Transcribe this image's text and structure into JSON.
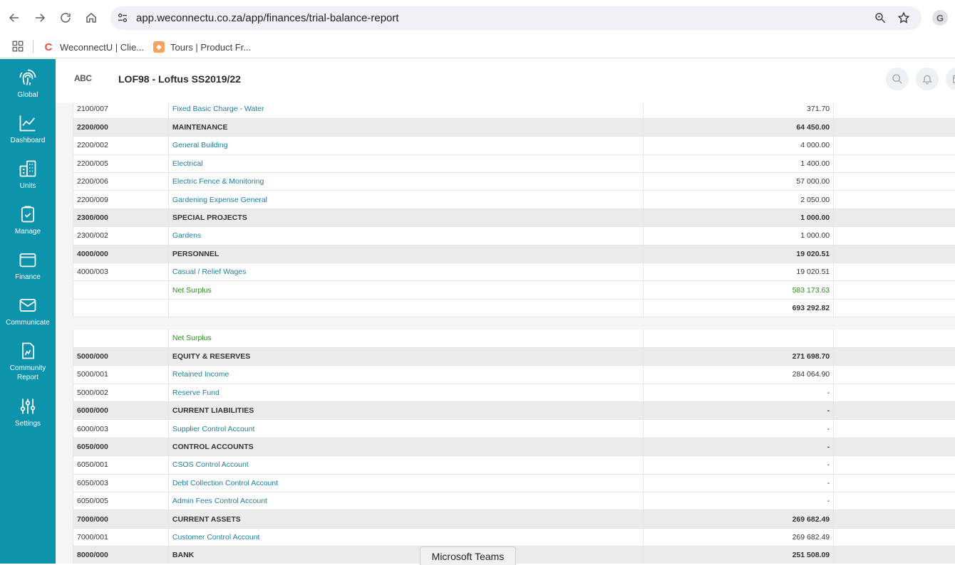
{
  "browser": {
    "url": "app.weconnectu.co.za/app/finances/trial-balance-report",
    "bookmarks": [
      {
        "label": "WeconnectU | Clie..."
      },
      {
        "label": "Tours | Product Fr..."
      }
    ],
    "profile_letter": "G"
  },
  "sidebar": {
    "items": [
      {
        "label": "Global",
        "icon": "fingerprint-icon"
      },
      {
        "label": "Dashboard",
        "icon": "line-chart-icon"
      },
      {
        "label": "Units",
        "icon": "building-icon"
      },
      {
        "label": "Manage",
        "icon": "clipboard-check-icon"
      },
      {
        "label": "Finance",
        "icon": "wallet-icon"
      },
      {
        "label": "Communicate",
        "icon": "envelope-icon"
      },
      {
        "label": "Community",
        "label2": "Report",
        "icon": "report-icon"
      },
      {
        "label": "Settings",
        "icon": "sliders-icon"
      }
    ]
  },
  "header": {
    "logo": "ABC",
    "title": "LOF98 - Loftus SS2019/22"
  },
  "table1": [
    {
      "code": "2100/007",
      "name": "Fixed Basic Charge - Water",
      "amount": "371.70",
      "type": "item"
    },
    {
      "code": "2200/000",
      "name": "MAINTENANCE",
      "amount": "64 450.00",
      "type": "head"
    },
    {
      "code": "2200/002",
      "name": "General Building",
      "amount": "4 000.00",
      "type": "item"
    },
    {
      "code": "2200/005",
      "name": "Electrical",
      "amount": "1 400.00",
      "type": "item"
    },
    {
      "code": "2200/006",
      "name": "Electric Fence & Monitoring",
      "amount": "57 000.00",
      "type": "item"
    },
    {
      "code": "2200/009",
      "name": "Gardening Expense General",
      "amount": "2 050.00",
      "type": "item"
    },
    {
      "code": "2300/000",
      "name": "SPECIAL PROJECTS",
      "amount": "1 000.00",
      "type": "head"
    },
    {
      "code": "2300/002",
      "name": "Gardens",
      "amount": "1 000.00",
      "type": "item"
    },
    {
      "code": "4000/000",
      "name": "PERSONNEL",
      "amount": "19 020.51",
      "type": "head"
    },
    {
      "code": "4000/003",
      "name": "Casual / Relief Wages",
      "amount": "19 020.51",
      "type": "item"
    },
    {
      "code": "",
      "name": "Net Surplus",
      "amount": "583 173.63",
      "type": "surplus"
    },
    {
      "code": "",
      "name": "",
      "amount": "693 292.82",
      "type": "total"
    }
  ],
  "table2": [
    {
      "code": "",
      "name": "Net Surplus",
      "amount": "",
      "type": "surplus"
    },
    {
      "code": "5000/000",
      "name": "EQUITY & RESERVES",
      "amount": "271 698.70",
      "type": "head"
    },
    {
      "code": "5000/001",
      "name": "Retained Income",
      "amount": "284 064.90",
      "type": "item"
    },
    {
      "code": "5000/002",
      "name": "Reserve Fund",
      "amount": "-",
      "type": "item"
    },
    {
      "code": "6000/000",
      "name": "CURRENT LIABILITIES",
      "amount": "-",
      "type": "head"
    },
    {
      "code": "6000/003",
      "name": "Supplier Control Account",
      "amount": "-",
      "type": "item"
    },
    {
      "code": "6050/000",
      "name": "CONTROL ACCOUNTS",
      "amount": "-",
      "type": "head"
    },
    {
      "code": "6050/001",
      "name": "CSOS Control Account",
      "amount": "-",
      "type": "item"
    },
    {
      "code": "6050/003",
      "name": "Debt Collection Control Account",
      "amount": "-",
      "type": "item"
    },
    {
      "code": "6050/005",
      "name": "Admin Fees Control Account",
      "amount": "-",
      "type": "item"
    },
    {
      "code": "7000/000",
      "name": "CURRENT ASSETS",
      "amount": "269 682.49",
      "type": "head"
    },
    {
      "code": "7000/001",
      "name": "Customer Control Account",
      "amount": "269 682.49",
      "type": "item"
    },
    {
      "code": "8000/000",
      "name": "BANK",
      "amount": "251 508.09",
      "type": "head"
    }
  ],
  "popup": {
    "label": "Microsoft Teams"
  }
}
